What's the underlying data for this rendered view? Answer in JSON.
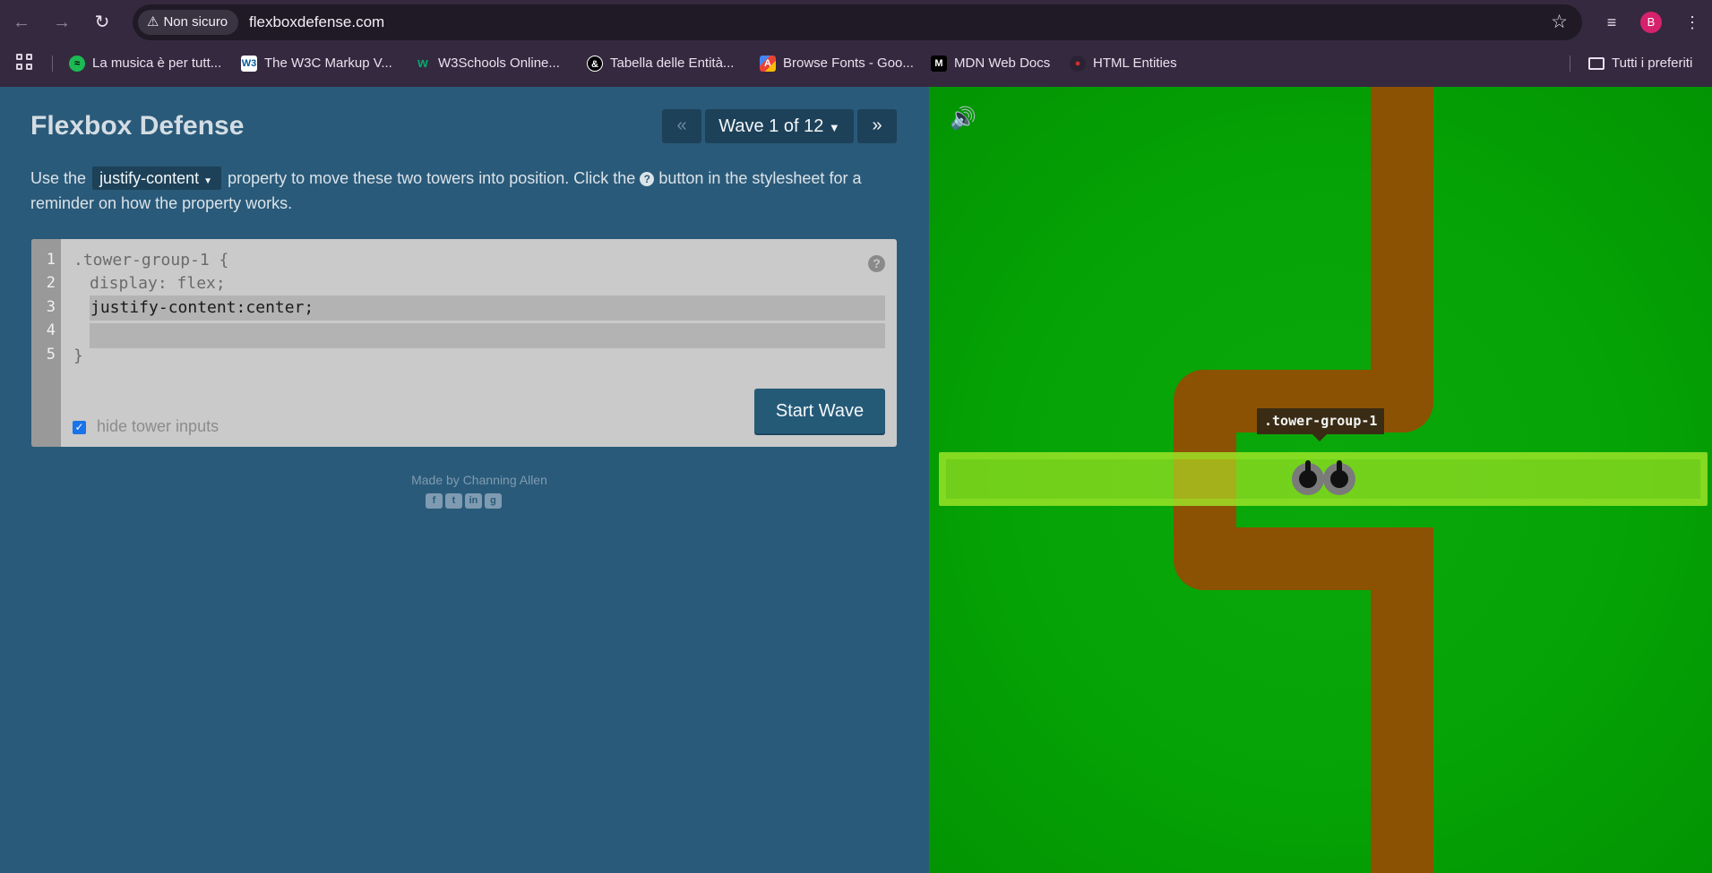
{
  "browser": {
    "security_label": "Non sicuro",
    "url": "flexboxdefense.com",
    "avatar_letter": "B",
    "bookmarks": [
      {
        "label": "La musica è per tutt...",
        "color": "#1db954"
      },
      {
        "label": "The W3C Markup V...",
        "color": "#ffffff"
      },
      {
        "label": "W3Schools Online...",
        "color": "#04aa6d"
      },
      {
        "label": "Tabella delle Entità...",
        "color": "#000000"
      },
      {
        "label": "Browse Fonts - Goo...",
        "color": "#fbbc04"
      },
      {
        "label": "MDN Web Docs",
        "color": "#000000"
      },
      {
        "label": "HTML Entities",
        "color": "#d32f2f"
      }
    ],
    "all_bookmarks_label": "Tutti i preferiti"
  },
  "game": {
    "title": "Flexbox Defense",
    "wave": {
      "label": "Wave 1 of 12",
      "current": 1,
      "total": 12
    },
    "instructions": {
      "before": "Use the",
      "property": "justify-content",
      "middle": "property to move these two towers into position. Click the",
      "after": "button in the stylesheet for a reminder on how the property works."
    },
    "editor": {
      "line_numbers": [
        "1",
        "2",
        "3",
        "4",
        "5"
      ],
      "selector_line": ".tower-group-1 {",
      "display_line": "display: flex;",
      "input_1_value": "justify-content:center;",
      "input_2_value": "",
      "closing_line": "}",
      "hide_inputs_label": "hide tower inputs",
      "hide_inputs_checked": true,
      "start_button": "Start Wave"
    },
    "credit": "Made by Channing Allen",
    "socials": [
      "facebook-icon",
      "twitter-icon",
      "linkedin-icon",
      "github-icon"
    ],
    "board": {
      "tooltip": ".tower-group-1",
      "tower_count": 2,
      "colors": {
        "grass": "#05a305",
        "path": "#8c5204",
        "tower_row": "#b4eb28"
      }
    }
  }
}
